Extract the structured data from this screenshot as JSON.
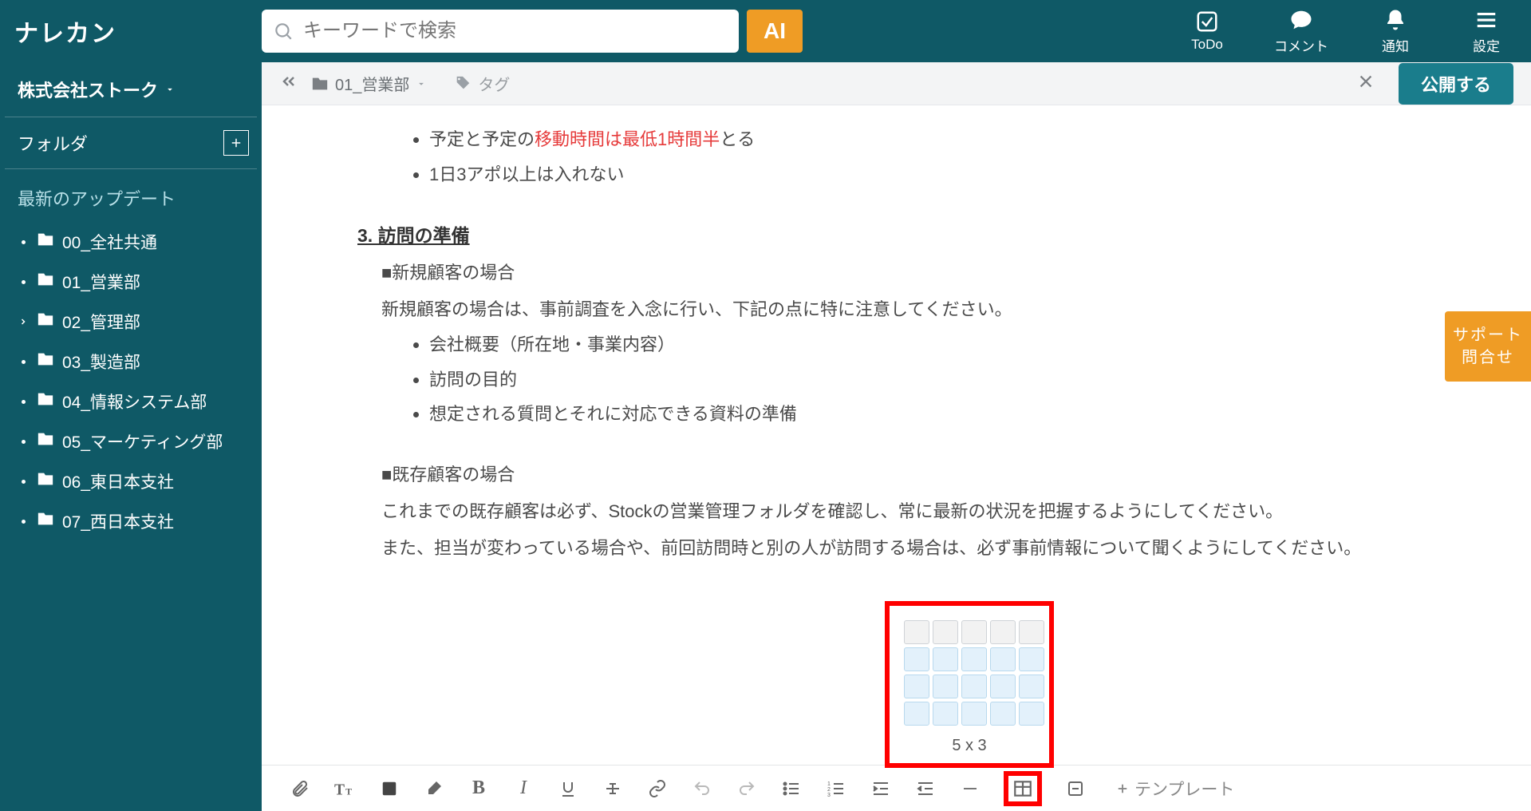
{
  "header": {
    "logo": "ナレカン",
    "search_placeholder": "キーワードで検索",
    "ai_button": "AI",
    "nav": {
      "todo": "ToDo",
      "comment": "コメント",
      "notify": "通知",
      "settings": "設定"
    }
  },
  "sidebar": {
    "organization": "株式会社ストーク",
    "folder_header": "フォルダ",
    "updates_header": "最新のアップデート",
    "folders": [
      {
        "label": "00_全社共通",
        "expandable": false
      },
      {
        "label": "01_営業部",
        "expandable": false
      },
      {
        "label": "02_管理部",
        "expandable": true
      },
      {
        "label": "03_製造部",
        "expandable": false
      },
      {
        "label": "04_情報システム部",
        "expandable": false
      },
      {
        "label": "05_マーケティング部",
        "expandable": false
      },
      {
        "label": "06_東日本支社",
        "expandable": false
      },
      {
        "label": "07_西日本支社",
        "expandable": false
      }
    ]
  },
  "breadcrumb": {
    "folder": "01_営業部",
    "tag": "タグ",
    "publish": "公開する"
  },
  "content": {
    "bullet1_prefix": "予定と予定の",
    "bullet1_highlight": "移動時間は最低1時間半",
    "bullet1_suffix": "とる",
    "bullet2": "1日3アポ以上は入れない",
    "section3_title": "3. 訪問の準備",
    "new_customer_hdr": "■新規顧客の場合",
    "new_customer_desc": "新規顧客の場合は、事前調査を入念に行い、下記の点に特に注意してください。",
    "new_customer_bullets": [
      "会社概要（所在地・事業内容）",
      "訪問の目的",
      "想定される質問とそれに対応できる資料の準備"
    ],
    "existing_customer_hdr": "■既存顧客の場合",
    "existing_customer_p1": "これまでの既存顧客は必ず、Stockの営業管理フォルダを確認し、常に最新の状況を把握するようにしてください。",
    "existing_customer_p2": "また、担当が変わっている場合や、前回訪問時と別の人が訪問する場合は、必ず事前情報について聞くようにしてください。"
  },
  "table_picker": {
    "label": "5 x 3"
  },
  "toolbar": {
    "template": "テンプレート"
  },
  "support_tab": {
    "line1": "サポート",
    "line2": "問合せ"
  }
}
